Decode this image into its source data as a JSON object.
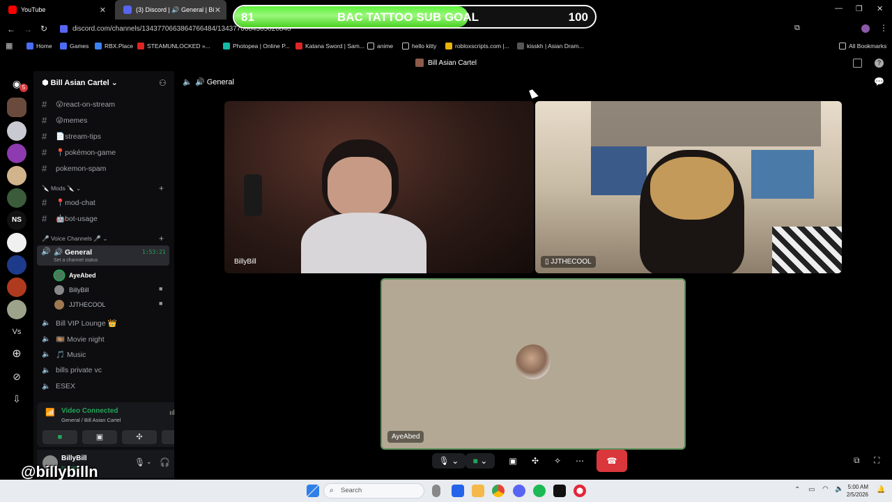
{
  "browser": {
    "tabs": [
      {
        "title": "YouTube"
      },
      {
        "title": "(3) Discord | 🔊 General | Bi"
      }
    ],
    "url": "discord.com/channels/1343770663864766484/1343770664305020848",
    "bookmarks": [
      "Home",
      "Games",
      "RBX.Place",
      "STEAMUNLOCKED »...",
      "Photopea | Online P...",
      "Katana Sword | Sam...",
      "anime",
      "hello kitty",
      "robloxscripts.com |...",
      "kisskh | Asian Dram...",
      "All Bookmarks"
    ]
  },
  "sub_goal": {
    "current": "81",
    "title": "BAC TATTOO SUB GOAL",
    "target": "100",
    "progress_fraction": 0.81
  },
  "discord": {
    "window_title": "Bill Asian Cartel",
    "server_name": "Bill Asian Cartel",
    "badge_count": "5",
    "channels": [
      {
        "icon": "😮",
        "name": "react-on-stream"
      },
      {
        "icon": "😜",
        "name": "memes"
      },
      {
        "icon": "📄",
        "name": "stream-tips"
      },
      {
        "icon": "📍",
        "name": "pokémon-game"
      },
      {
        "icon": "",
        "name": "pokemon-spam"
      }
    ],
    "mods_category": "🔪 Mods 🔪",
    "mod_channels": [
      {
        "icon": "📍",
        "name": "mod-chat"
      },
      {
        "icon": "🤖",
        "name": "bot-usage"
      }
    ],
    "voice_category": "🎤 Voice Channels 🎤",
    "active_voice": {
      "name": "🔊 General",
      "timer": "1:53:21",
      "status_hint": "Set a channel status"
    },
    "voice_users": [
      "AyeAbed",
      "BillyBill",
      "JJTHECOOL"
    ],
    "other_voice": [
      "Bill VIP Lounge 👑",
      "🎞️ Movie night",
      "🎵 Music",
      "bills private vc",
      "ESEX"
    ],
    "connection": {
      "status": "Video Connected",
      "location": "General / Bill Asian Cartel"
    },
    "user": {
      "name": "BillyBill",
      "status": "In voice"
    },
    "header_channel": "🔊 General",
    "participants": [
      {
        "name": "BillyBill"
      },
      {
        "name": "JJTHECOOL"
      },
      {
        "name": "AyeAbed"
      }
    ]
  },
  "taskbar": {
    "search_placeholder": "Search",
    "time": "5:00 AM",
    "date": "2/5/2026"
  },
  "watermark": "@billybilln",
  "colors": {
    "discord_green": "#23a55a",
    "hangup_red": "#da373c",
    "goal_green": "#5cf23a",
    "speaking_border": "#5a8f5a"
  }
}
